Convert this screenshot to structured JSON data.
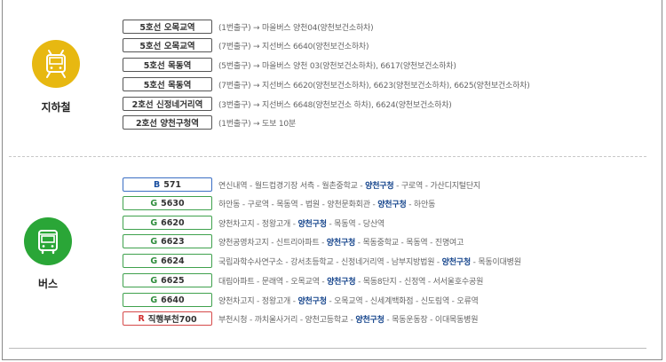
{
  "colors": {
    "subway_icon_bg": "#e7b811",
    "bus_icon_bg": "#2aa637",
    "highlight": "#17468d",
    "bus_b": "#1a4fa0",
    "bus_g": "#2f8d3d",
    "bus_r": "#d12f2f"
  },
  "subway": {
    "label": "지하철",
    "icon": "subway-train-icon",
    "rows": [
      {
        "station": "5호선 오목교역",
        "route": "(1번출구) → 마을버스 양천04(양천보건소하차)"
      },
      {
        "station": "5호선 오목교역",
        "route": "(7번출구) → 지선버스 6640(양천보건소하차)"
      },
      {
        "station": "5호선 목동역",
        "route": "(5번출구) → 마을버스 양천 03(양천보건소하차), 6617(양천보건소하차)"
      },
      {
        "station": "5호선 목동역",
        "route": "(7번출구) → 지선버스 6620(양천보건소하차), 6623(양천보건소하차), 6625(양천보건소하차)"
      },
      {
        "station": "2호선 신정네거리역",
        "route": "(3번출구) → 지선버스 6648(양천보건소 하차), 6624(양천보건소하차)"
      },
      {
        "station": "2호선 양천구청역",
        "route": "(1번출구) → 도보 10분"
      }
    ]
  },
  "bus": {
    "label": "버스",
    "icon": "bus-icon",
    "rows": [
      {
        "code": "B",
        "color": "#1a4fa0",
        "border": "#3b6fc4",
        "number": "571",
        "before": "연신내역 - 월드컵경기장 서측 - 월촌중학교 - ",
        "hl": "양천구청",
        "after": " - 구로역 - 가산디지털단지"
      },
      {
        "code": "G",
        "color": "#2f8d3d",
        "border": "#3fa14d",
        "number": "5630",
        "before": "하안동 - 구로역 - 목동역 - 법원 - 양천문화회관 - ",
        "hl": "양천구청",
        "after": " - 하안동"
      },
      {
        "code": "G",
        "color": "#2f8d3d",
        "border": "#3fa14d",
        "number": "6620",
        "before": "양천차고지 - 정왕고개 - ",
        "hl": "양천구청",
        "after": " - 목동역 - 당산역"
      },
      {
        "code": "G",
        "color": "#2f8d3d",
        "border": "#3fa14d",
        "number": "6623",
        "before": "양천공영차고지 - 신트리아파트 - ",
        "hl": "양천구청",
        "after": " - 목동중학교 - 목동역 - 진명여고"
      },
      {
        "code": "G",
        "color": "#2f8d3d",
        "border": "#3fa14d",
        "number": "6624",
        "before": "국립과학수사연구소 - 강서초등학교 - 신정네거리역 - 남부지방법원 - ",
        "hl": "양천구청",
        "after": " - 목동이대병원"
      },
      {
        "code": "G",
        "color": "#2f8d3d",
        "border": "#3fa14d",
        "number": "6625",
        "before": "대림아파트 - 문래역 - 오목교역 - ",
        "hl": "양천구청",
        "after": " - 목동8단지 - 신정역 - 서서울호수공원"
      },
      {
        "code": "G",
        "color": "#2f8d3d",
        "border": "#3fa14d",
        "number": "6640",
        "before": "양천차고지 - 정왕고개 - ",
        "hl": "양천구청",
        "after": " - 오목교역 - 신세계백화점 - 신도림역 - 오류역"
      },
      {
        "code": "R",
        "color": "#d12f2f",
        "border": "#d64a4a",
        "number": "직행부천700",
        "before": "부천시청 - 까치울사거리 - 양천고등학교 - ",
        "hl": "양천구청",
        "after": " - 목동운동장 - 이대목동병원"
      }
    ]
  }
}
